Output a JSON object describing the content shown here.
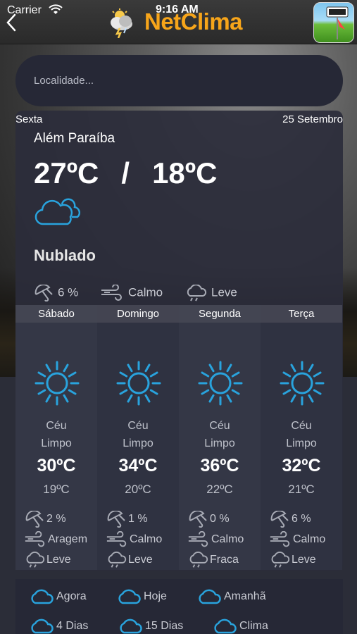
{
  "status_bar": {
    "carrier": "Carrier",
    "time": "9:16 AM"
  },
  "header": {
    "title": "NetClima",
    "back_icon": "chevron-left-icon",
    "logo_icon": "cloud-lightning-icon",
    "app_icon": "weather-app-icon"
  },
  "search": {
    "placeholder": "Localidade...",
    "value": ""
  },
  "current": {
    "day": "Sexta",
    "date": "25 Setembro",
    "city": "Além Paraíba",
    "max_temp": "27ºC",
    "separator": "/",
    "min_temp": "18ºC",
    "icon": "cloudy-icon",
    "condition": "Nublado",
    "rain": "6 %",
    "wind": "Calmo",
    "cloud": "Leve"
  },
  "forecast": [
    {
      "day": "Sábado",
      "cond1": "Céu",
      "cond2": "Limpo",
      "max": "30ºC",
      "min": "19ºC",
      "rain": "2 %",
      "wind": "Aragem",
      "cloud": "Leve"
    },
    {
      "day": "Domingo",
      "cond1": "Céu",
      "cond2": "Limpo",
      "max": "34ºC",
      "min": "20ºC",
      "rain": "1 %",
      "wind": "Calmo",
      "cloud": "Leve"
    },
    {
      "day": "Segunda",
      "cond1": "Céu",
      "cond2": "Limpo",
      "max": "36ºC",
      "min": "22ºC",
      "rain": "0 %",
      "wind": "Calmo",
      "cloud": "Fraca"
    },
    {
      "day": "Terça",
      "cond1": "Céu",
      "cond2": "Limpo",
      "max": "32ºC",
      "min": "21ºC",
      "rain": "6 %",
      "wind": "Calmo",
      "cloud": "Leve"
    }
  ],
  "nav": {
    "now": "Agora",
    "today": "Hoje",
    "tomorrow": "Amanhã",
    "four_days": "4 Dias",
    "fifteen_days": "15 Dias",
    "climate": "Clima"
  },
  "colors": {
    "accent": "#f7a51a",
    "icon_blue": "#29a3dd",
    "card_bg": "#2b2d3b"
  }
}
